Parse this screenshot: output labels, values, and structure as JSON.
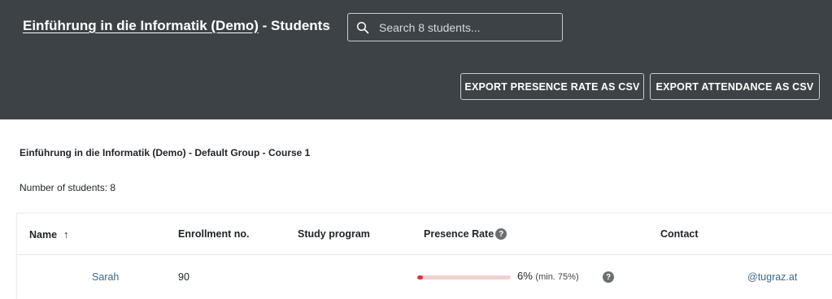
{
  "header": {
    "course_link": "Einführung in die Informatik (Demo)",
    "title_suffix": " - Students",
    "search_placeholder": "Search 8 students...",
    "export_presence_label": "EXPORT PRESENCE RATE AS CSV",
    "export_attendance_label": "EXPORT ATTENDANCE AS CSV"
  },
  "group_title": "Einführung in die Informatik (Demo) - Default Group - Course 1",
  "student_count": "Number of students: 8",
  "table": {
    "columns": {
      "name": "Name",
      "sort_icon": "↑",
      "enrollment": "Enrollment no.",
      "program": "Study program",
      "presence": "Presence Rate",
      "contact": "Contact"
    },
    "rows": [
      {
        "name": "Sarah",
        "enrollment": "90",
        "program": "",
        "presence_fraction": 0.06,
        "presence_value": "6%",
        "presence_min": "(min. 75%)",
        "contact": "@tugraz.at"
      }
    ]
  },
  "colors": {
    "header_bg": "#3d4246",
    "bar_fill": "#d83a3a",
    "bar_track": "#f3d1d1",
    "link": "#3d6a8f"
  },
  "icons": {
    "search": "search-icon",
    "sort": "arrow-up-icon",
    "help": "help-circle-icon"
  }
}
